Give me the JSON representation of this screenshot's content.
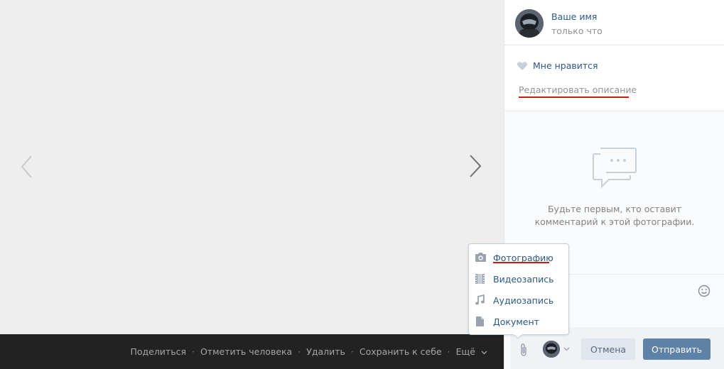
{
  "viewer": {
    "prev_icon": "chevron-left-icon",
    "next_icon": "chevron-right-icon"
  },
  "actions": {
    "share": "Поделиться",
    "tag_person": "Отметить человека",
    "delete": "Удалить",
    "save": "Сохранить к себе",
    "more": "Ещё",
    "separator": "·"
  },
  "author": {
    "name": "Ваше имя",
    "time": "только что"
  },
  "likes": {
    "label": "Мне нравится",
    "edit_description": "Редактировать описание"
  },
  "comments": {
    "empty_text": "Будьте первым, кто оставит комментарий к этой фотографии."
  },
  "compose": {
    "cancel_label": "Отмена",
    "send_label": "Отправить"
  },
  "attach_menu": {
    "items": [
      {
        "label": "Фотографию",
        "icon": "camera-icon"
      },
      {
        "label": "Видеозапись",
        "icon": "film-icon"
      },
      {
        "label": "Аудиозапись",
        "icon": "music-note-icon"
      },
      {
        "label": "Документ",
        "icon": "document-icon"
      }
    ]
  },
  "colors": {
    "link": "#2a5885",
    "accent_underline": "#d21515",
    "send_button": "#5e81a8",
    "dark_bar": "#222222"
  }
}
